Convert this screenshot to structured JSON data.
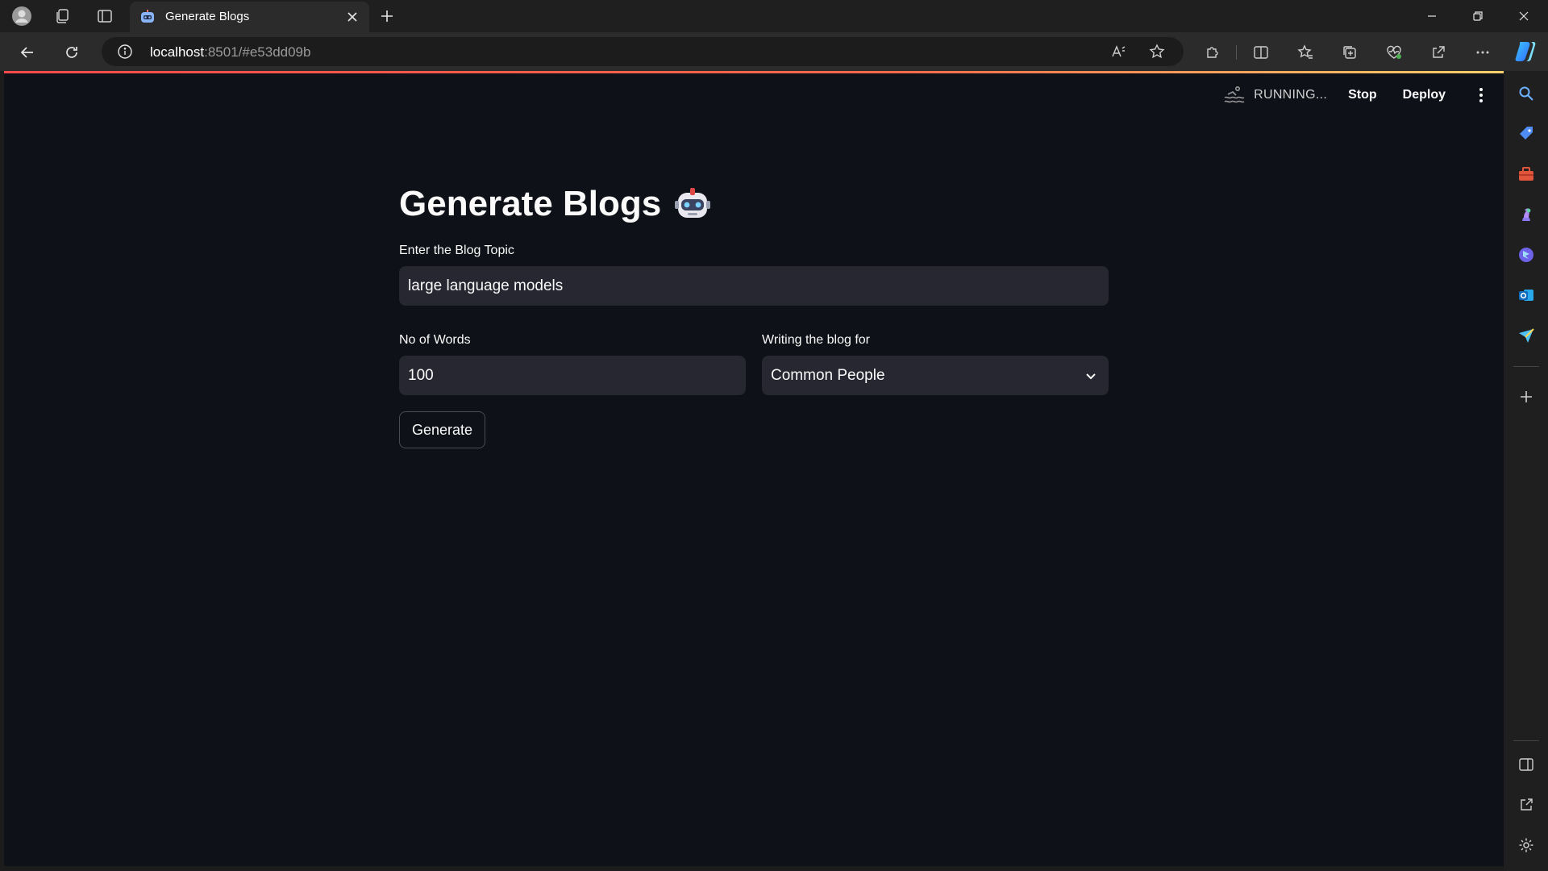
{
  "browser": {
    "tab": {
      "title": "Generate Blogs"
    },
    "address": {
      "host": "localhost",
      "rest": ":8501/#e53dd09b"
    },
    "icons": {
      "profile": "profile-icon",
      "workspaces": "workspaces-icon",
      "tab_actions": "tab-actions-icon",
      "new_tab": "plus-icon",
      "back": "back-arrow-icon",
      "refresh": "refresh-icon",
      "site_info": "info-icon",
      "read_aloud": "read-aloud-icon",
      "favorite": "star-icon",
      "extensions": "extensions-icon",
      "split_screen": "split-screen-icon",
      "favorites": "favorites-icon",
      "collections": "collections-icon",
      "browser_essentials": "heart-pulse-icon",
      "share": "share-icon",
      "more": "more-icon",
      "copilot": "copilot-icon"
    }
  },
  "app": {
    "status": "RUNNING...",
    "stop_label": "Stop",
    "deploy_label": "Deploy",
    "title": "Generate Blogs",
    "topic": {
      "label": "Enter the Blog Topic",
      "value": "large language models"
    },
    "words": {
      "label": "No of Words",
      "value": "100"
    },
    "audience": {
      "label": "Writing the blog for",
      "value": "Common People"
    },
    "generate_label": "Generate"
  },
  "sidebar": {
    "items": [
      "search-icon",
      "tag-icon",
      "toolbox-icon",
      "chess-icon",
      "bing-icon",
      "outlook-icon",
      "send-icon",
      "plus-icon",
      "panel-icon",
      "external-link-icon",
      "gear-icon"
    ]
  },
  "colors": {
    "page_bg": "#0e1117",
    "input_bg": "#262730",
    "accent": "#ff4b4b",
    "chrome_bg": "#1f1f1f",
    "toolbar_bg": "#2b2b2b"
  }
}
